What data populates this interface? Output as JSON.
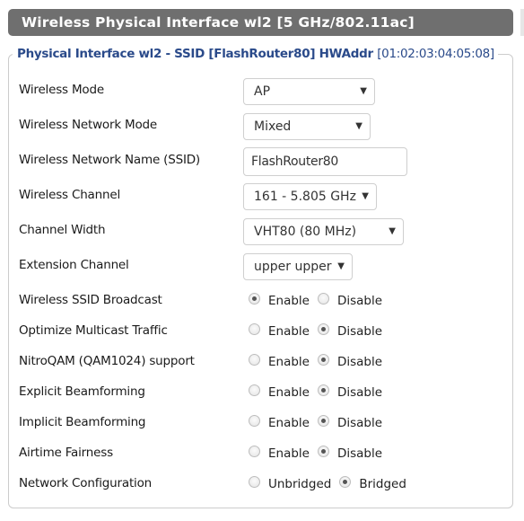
{
  "header": {
    "title": "Wireless Physical Interface wl2 [5 GHz/802.11ac]"
  },
  "panel": {
    "legend_bold": "Physical Interface wl2 - SSID [FlashRouter80] HWAddr",
    "legend_hwaddr": "[01:02:03:04:05:08]"
  },
  "fields": {
    "wireless_mode": {
      "label": "Wireless Mode",
      "value": "AP"
    },
    "network_mode": {
      "label": "Wireless Network Mode",
      "value": "Mixed"
    },
    "ssid": {
      "label": "Wireless Network Name (SSID)",
      "value": "FlashRouter80"
    },
    "channel": {
      "label": "Wireless Channel",
      "value": "161 - 5.805 GHz"
    },
    "channel_width": {
      "label": "Channel Width",
      "value": "VHT80 (80 MHz)"
    },
    "extension_channel": {
      "label": "Extension Channel",
      "value": "upper upper"
    }
  },
  "dropdown_arrow": "▼",
  "radios": [
    {
      "label": "Wireless SSID Broadcast",
      "options": [
        "Enable",
        "Disable"
      ],
      "selected": "Enable"
    },
    {
      "label": "Optimize Multicast Traffic",
      "options": [
        "Enable",
        "Disable"
      ],
      "selected": "Disable"
    },
    {
      "label": "NitroQAM (QAM1024) support",
      "options": [
        "Enable",
        "Disable"
      ],
      "selected": "Disable"
    },
    {
      "label": "Explicit Beamforming",
      "options": [
        "Enable",
        "Disable"
      ],
      "selected": "Disable"
    },
    {
      "label": "Implicit Beamforming",
      "options": [
        "Enable",
        "Disable"
      ],
      "selected": "Disable"
    },
    {
      "label": "Airtime Fairness",
      "options": [
        "Enable",
        "Disable"
      ],
      "selected": "Disable"
    },
    {
      "label": "Network Configuration",
      "options": [
        "Unbridged",
        "Bridged"
      ],
      "selected": "Bridged"
    }
  ]
}
